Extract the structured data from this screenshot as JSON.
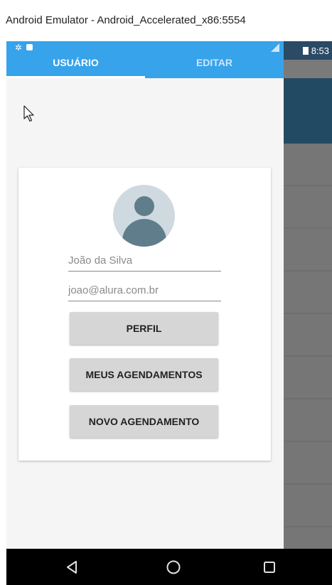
{
  "window": {
    "title": "Android Emulator - Android_Accelerated_x86:5554"
  },
  "status_bar": {
    "time": "8:53"
  },
  "tabs": [
    {
      "label": "USUÁRIO",
      "selected": true
    },
    {
      "label": "EDITAR",
      "selected": false
    }
  ],
  "profile": {
    "name": "João da Silva",
    "email": "joao@alura.com.br"
  },
  "buttons": {
    "perfil": "PERFIL",
    "meus_agendamentos": "MEUS AGENDAMENTOS",
    "novo_agendamento": "NOVO AGENDAMENTO"
  },
  "icons": {
    "avatar": "person-avatar-icon",
    "back": "back-triangle-icon",
    "home": "home-circle-icon",
    "recent": "recent-apps-square-icon",
    "cursor": "mouse-pointer-icon"
  },
  "colors": {
    "tab_bar": "#36a3eb",
    "button_bg": "#d6d6d6",
    "avatar_fg": "#607d8b",
    "avatar_bg": "#cfd9e0"
  }
}
